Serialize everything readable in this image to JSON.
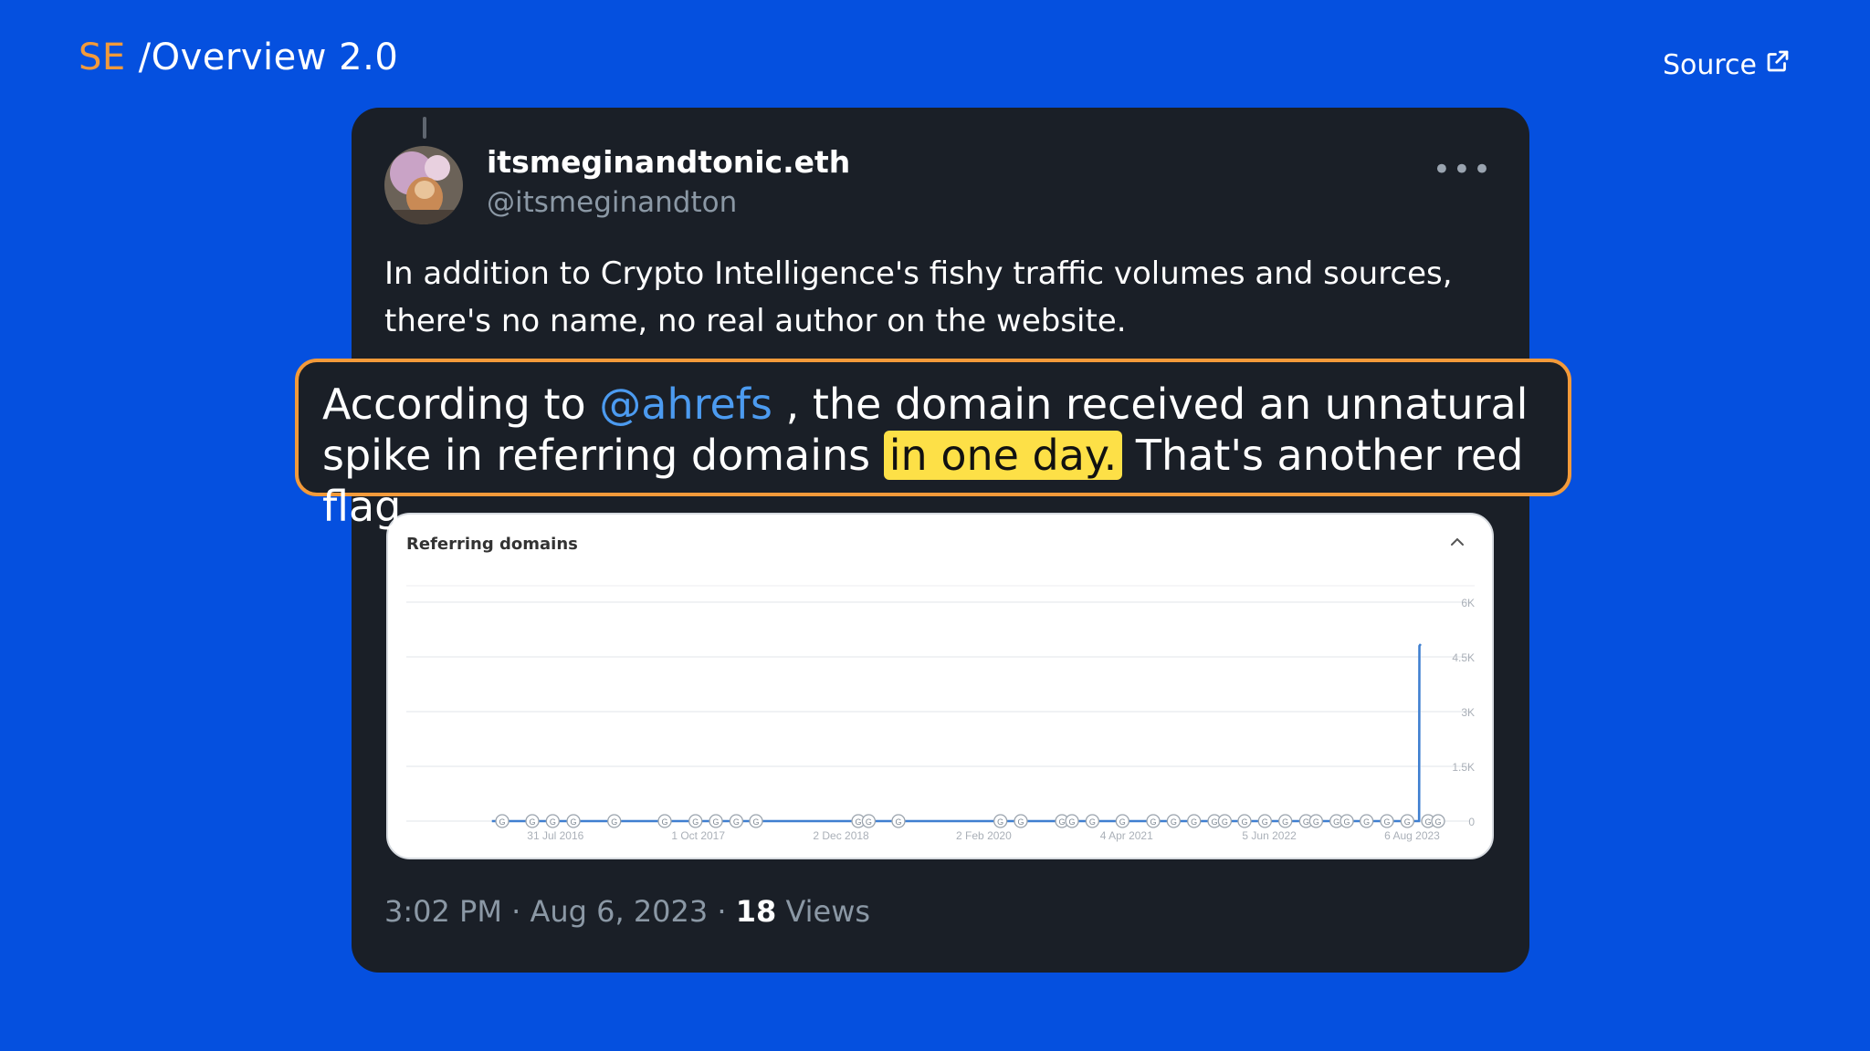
{
  "header": {
    "brand_mark": "SE",
    "brand_path": "/Overview 2.0",
    "source_label": "Source"
  },
  "tweet": {
    "display_name": "itsmeginandtonic.eth",
    "handle": "@itsmeginandton",
    "more_label": "•••",
    "text": "In addition to Crypto Intelligence's fishy traffic volumes and sources, there's no name, no real author on the website.",
    "timestamp": "3:02 PM · Aug 6, 2023 · ",
    "views_count": "18",
    "views_label": " Views"
  },
  "callout": {
    "prefix": "According to ",
    "mention": "@ahrefs",
    "middle": " , the domain received an unnatural spike in referring domains ",
    "highlight": "in one day.",
    "suffix": " That's another red flag."
  },
  "colors": {
    "background": "#0550DF",
    "accent": "#F39A3A",
    "highlight": "#FDE047",
    "mention": "#4C9BF0",
    "card": "#1A1F27"
  },
  "icons": {
    "external_link": "external-link-icon",
    "collapse": "chevron-up-icon"
  },
  "chart_data": {
    "type": "area",
    "title": "Referring domains",
    "x_tick_labels": [
      "31 Jul 2016",
      "1 Oct 2017",
      "2 Dec 2018",
      "2 Feb 2020",
      "4 Apr 2021",
      "5 Jun 2022",
      "6 Aug 2023"
    ],
    "y_tick_labels": [
      "6K",
      "4.5K",
      "3K",
      "1.5K",
      "0"
    ],
    "ylim": [
      0,
      6000
    ],
    "y_axis_side": "right",
    "grid": true,
    "series": [
      {
        "x": [
          "2016-01",
          "2016-07",
          "2017-01",
          "2017-07",
          "2018-01",
          "2018-07",
          "2019-01",
          "2019-07",
          "2020-01",
          "2020-07",
          "2021-01",
          "2021-07",
          "2022-01",
          "2022-07",
          "2023-01",
          "2023-07",
          "2023-08-05",
          "2023-08-06",
          "2023-08-10"
        ],
        "values": [
          0,
          0,
          0,
          0,
          0,
          0,
          0,
          0,
          0,
          0,
          0,
          0,
          0,
          0,
          0,
          0,
          0,
          4800,
          4850
        ]
      }
    ],
    "annotation_marker_label": "G"
  }
}
